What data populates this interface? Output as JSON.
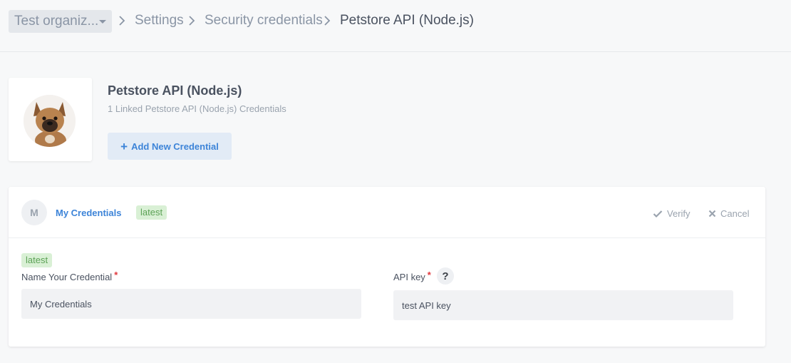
{
  "breadcrumb": {
    "org_select": "Test organiz...",
    "items": [
      "Settings",
      "Security credentials",
      "Petstore API (Node.js)"
    ]
  },
  "api": {
    "title": "Petstore API (Node.js)",
    "subtitle": "1 Linked Petstore API (Node.js) Credentials",
    "add_button": "Add New Credential",
    "add_icon": "+"
  },
  "credential": {
    "avatar_letter": "M",
    "name": "My Credentials",
    "header_badge": "latest",
    "verify_label": "Verify",
    "cancel_label": "Cancel",
    "form_badge": "latest",
    "name_field_label": "Name Your Credential",
    "name_field_value": "My Credentials",
    "api_key_label": "API key",
    "api_key_value": "test API key",
    "help_icon": "?",
    "required_mark": "*"
  },
  "colors": {
    "accent": "#3d84d8",
    "badge_bg": "#d9f0d5",
    "badge_text": "#5ca256",
    "required": "#e0393e"
  },
  "icons": [
    "chevron-right-icon",
    "caret-down-icon",
    "plus-icon",
    "check-icon",
    "close-icon",
    "help-icon"
  ]
}
